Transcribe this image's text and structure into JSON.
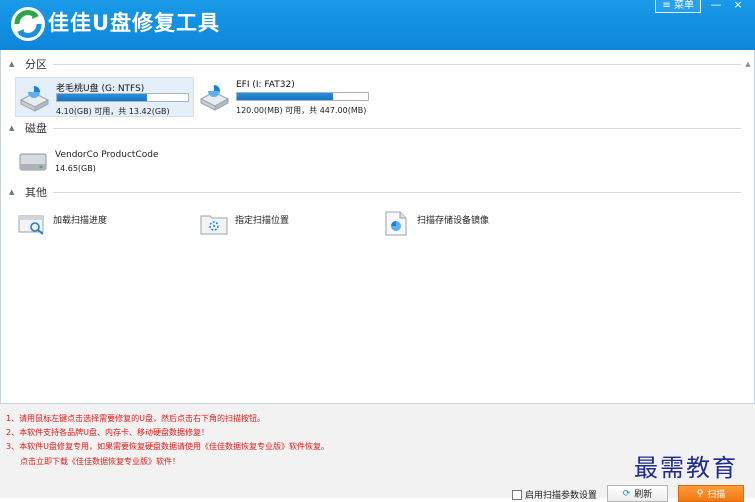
{
  "app": {
    "title": "佳佳U盘修复工具",
    "menu_label": "菜单",
    "minimize_glyph": "—",
    "close_glyph": "×"
  },
  "sections": {
    "partition": "分区",
    "disk": "磁盘",
    "other": "其他"
  },
  "partitions": [
    {
      "name": "老毛桃U盘 (G: NTFS)",
      "usage": "4.10(GB) 可用，共 13.42(GB)",
      "used_fraction": 0.69,
      "selected": true
    },
    {
      "name": "EFI (I: FAT32)",
      "usage": "120.00(MB) 可用，共 447.00(MB)",
      "used_fraction": 0.73,
      "selected": false
    }
  ],
  "disks": [
    {
      "name": "VendorCo ProductCode",
      "size": "14.65(GB)"
    }
  ],
  "tools": [
    {
      "label": "加载扫描进度",
      "icon": "load-scan-icon"
    },
    {
      "label": "指定扫描位置",
      "icon": "scan-location-icon"
    },
    {
      "label": "扫描存储设备镜像",
      "icon": "image-file-icon"
    }
  ],
  "tips": [
    "1、请用鼠标左键点击选择需要修复的U盘，然后点击右下角的扫描按钮。",
    "2、本软件支持各品牌U盘、内存卡、移动硬盘数据修复！",
    "3、本软件U盘修复专用，如果需要恢复硬盘数据请使用《佳佳数据恢复专业版》软件恢复。",
    "点击立即下载《佳佳数据恢复专业版》软件！"
  ],
  "watermark": "最需教育",
  "footer": {
    "advanced_settings_label": "启用扫描参数设置",
    "refresh_label": "刷新",
    "scan_label": "扫描"
  },
  "colors": {
    "titlebar": "#1590e0",
    "accent_orange": "#f07a12",
    "tip_red": "#e21b1b",
    "progress_blue": "#1a82d2"
  }
}
